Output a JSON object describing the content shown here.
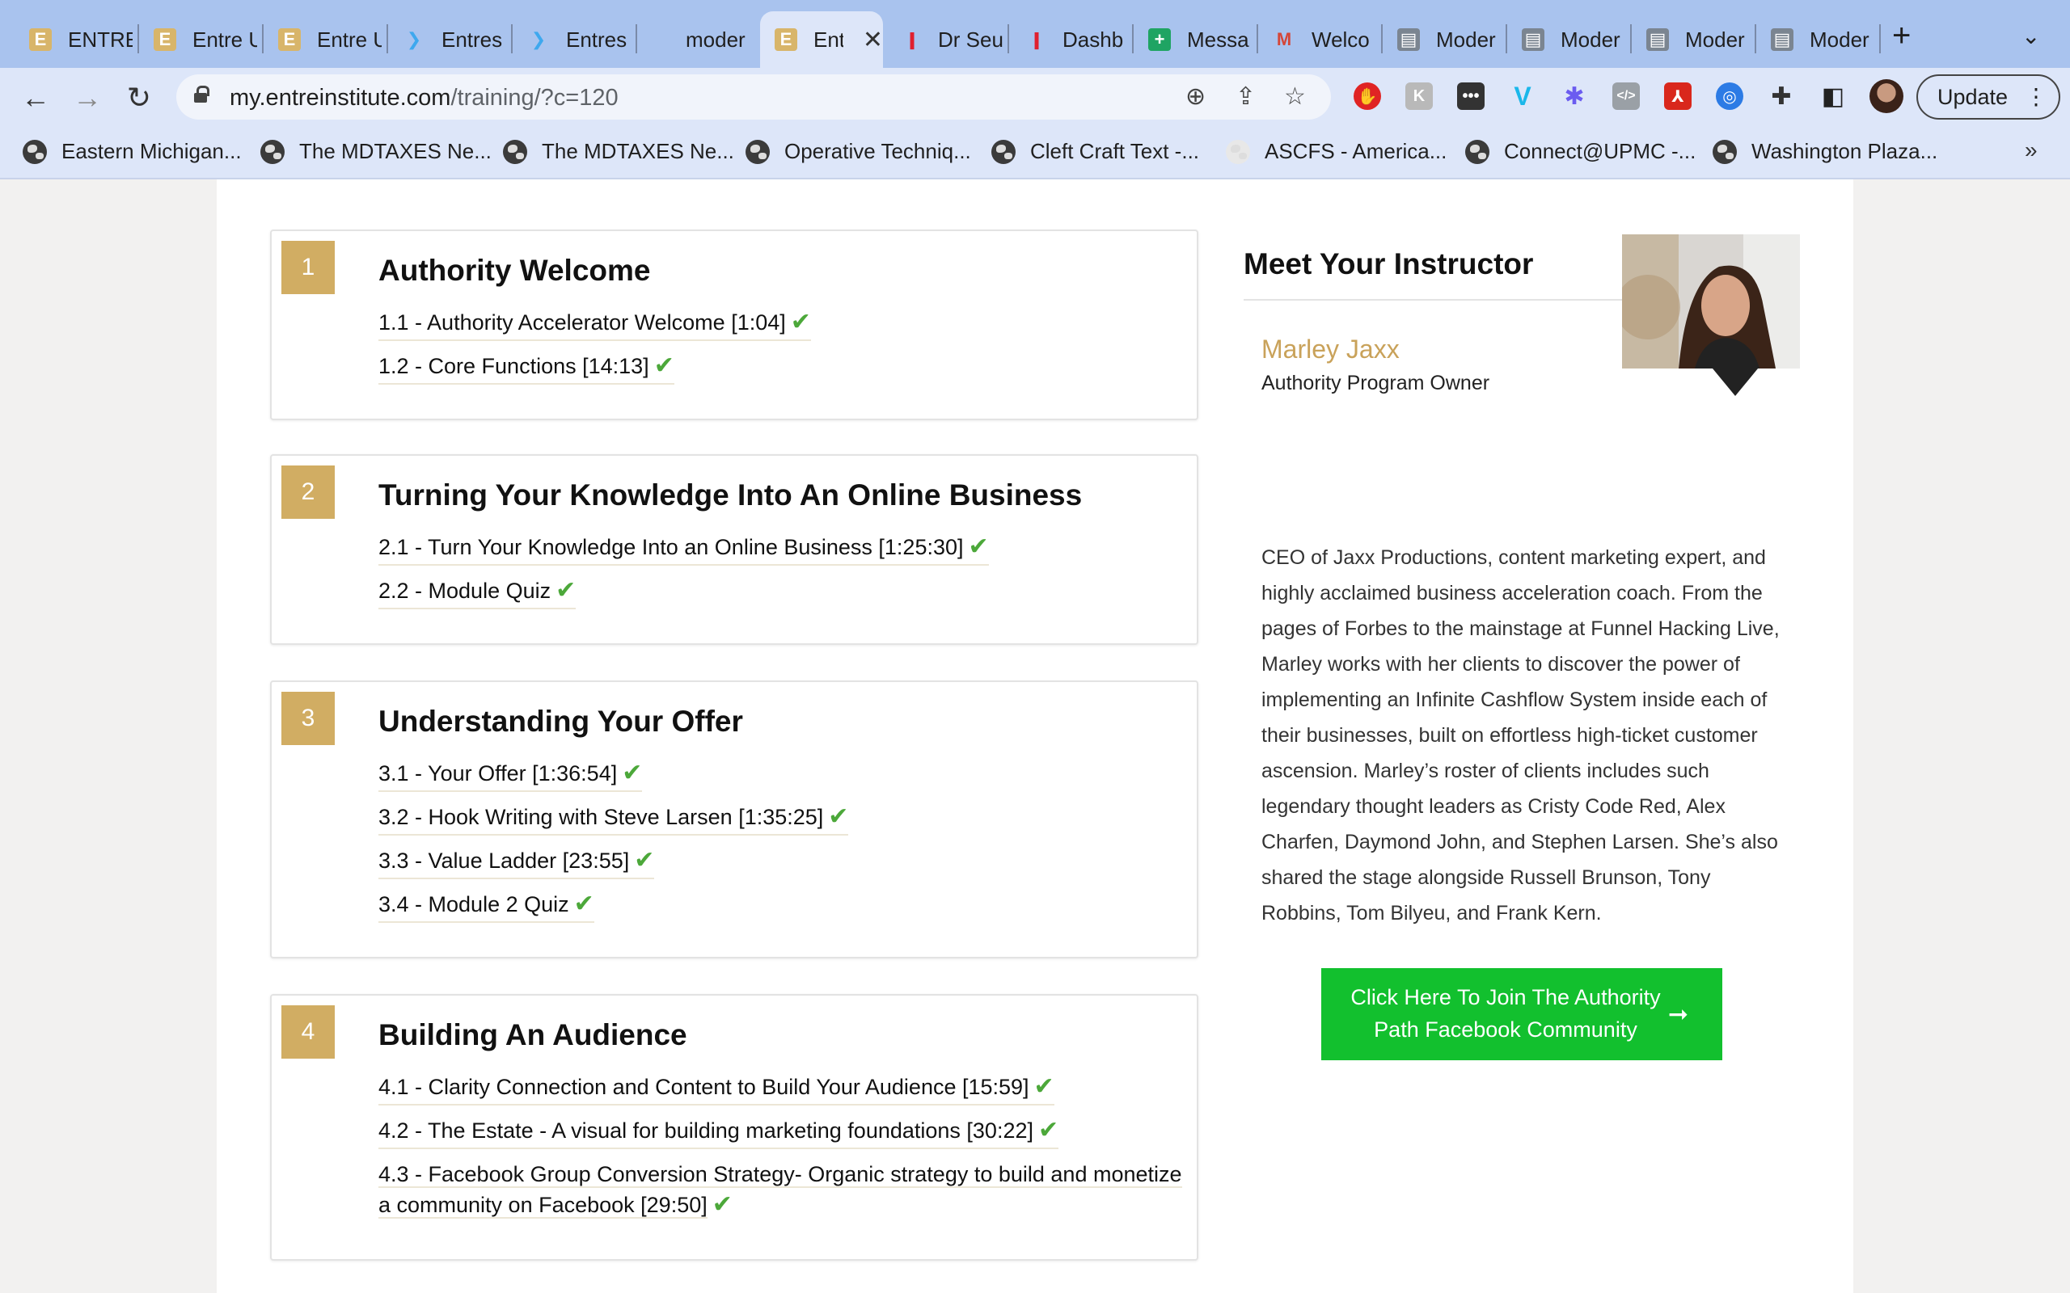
{
  "browser": {
    "tabs": [
      {
        "label": "ENTRE",
        "icon": "entre-logo-icon"
      },
      {
        "label": "Entre U",
        "icon": "entre-logo-icon"
      },
      {
        "label": "Entre U",
        "icon": "entre-logo-icon"
      },
      {
        "label": "Entres",
        "icon": "butterfly-icon"
      },
      {
        "label": "Entres",
        "icon": "butterfly-icon"
      },
      {
        "label": "moder",
        "icon": "none"
      },
      {
        "label": "Ent",
        "icon": "entre-logo-icon",
        "active": true
      },
      {
        "label": "Dr Seu",
        "icon": "red-bars-icon"
      },
      {
        "label": "Dashb",
        "icon": "red-bars-icon"
      },
      {
        "label": "Messa",
        "icon": "green-plus-icon"
      },
      {
        "label": "Welco",
        "icon": "gmail-icon"
      },
      {
        "label": "Moder",
        "icon": "site-thumbnail-icon"
      },
      {
        "label": "Moder",
        "icon": "site-thumbnail-icon"
      },
      {
        "label": "Moder",
        "icon": "site-thumbnail-icon"
      },
      {
        "label": "Moder",
        "icon": "site-thumbnail-icon"
      }
    ],
    "url_host": "my.entreinstitute.com",
    "url_path": "/training/?c=120",
    "update_label": "Update",
    "bookmarks": [
      "Eastern Michigan...",
      "The MDTAXES Ne...",
      "The MDTAXES Ne...",
      "Operative Techniq...",
      "Cleft Craft Text -...",
      "ASCFS - America...",
      "Connect@UPMC -...",
      "Washington Plaza..."
    ],
    "more_bookmarks": "»"
  },
  "modules": [
    {
      "number": "1",
      "title": "Authority Welcome",
      "lessons": [
        "1.1 - Authority Accelerator Welcome [1:04]",
        "1.2 - Core Functions [14:13]"
      ]
    },
    {
      "number": "2",
      "title": "Turning Your Knowledge Into An Online Business",
      "lessons": [
        "2.1 - Turn Your Knowledge Into an Online Business [1:25:30]",
        "2.2 - Module Quiz"
      ]
    },
    {
      "number": "3",
      "title": "Understanding Your Offer",
      "lessons": [
        "3.1 - Your Offer [1:36:54]",
        "3.2 - Hook Writing with Steve Larsen [1:35:25]",
        "3.3 - Value Ladder [23:55]",
        "3.4 - Module 2 Quiz"
      ]
    },
    {
      "number": "4",
      "title": "Building An Audience",
      "lessons": [
        "4.1 - Clarity Connection and Content to Build Your Audience [15:59]",
        "4.2 - The Estate - A visual for building marketing foundations [30:22]",
        "4.3 - Facebook Group Conversion Strategy- Organic strategy to build and monetize a community on Facebook [29:50]"
      ]
    }
  ],
  "instructor": {
    "heading": "Meet Your Instructor",
    "name": "Marley Jaxx",
    "role": "Authority Program Owner",
    "bio": "CEO of Jaxx Productions, content marketing expert, and highly acclaimed business acceleration coach. From the pages of Forbes to the mainstage at Funnel Hacking Live, Marley works with her clients to discover the power of implementing an Infinite Cashflow System inside each of their businesses, built on effortless high-ticket customer ascension. Marley’s roster of clients includes such legendary thought leaders as Cristy Code Red, Alex Charfen, Daymond John, and Stephen Larsen. She’s also shared the stage alongside Russell Brunson, Tony Robbins, Tom Bilyeu, and Frank Kern.",
    "cta": "Click Here To Join The Authority Path Facebook Community"
  },
  "colors": {
    "accent_gold": "#d1ad63",
    "name_gold": "#c9a25a",
    "check_green": "#4ca83a",
    "cta_green": "#12c02e",
    "tab_bar": "#a9c3ee",
    "toolbar": "#dde6f9"
  }
}
